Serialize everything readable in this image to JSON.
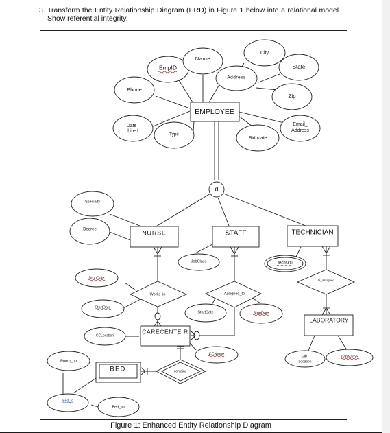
{
  "question": {
    "number": "3.",
    "text": "Transform the Entity Relationship Diagram (ERD) in Figure 1 below into a relational model. Show referential integrity."
  },
  "figure": {
    "caption": "Figure 1: Enhanced Entity Relationship Diagram",
    "specialization_symbol": "d",
    "entities": {
      "employee": "EMPLOYEE",
      "nurse": "NURSE",
      "staff": "STAFF",
      "technician": "TECHNICIAN",
      "carecenter": "CARECENTE R",
      "laboratory": "LABORATORY",
      "bed": "BED"
    },
    "relationships": {
      "works_in": "Works_in",
      "assigned_to": "Assigned_to",
      "is_assigned": "Is_assigned",
      "contains": "contains"
    },
    "attributes": {
      "empid": "EmpID",
      "name": "Name",
      "city": "City",
      "state": "State",
      "address": "Address",
      "zip": "Zip",
      "phone": "Phone",
      "date_hired_1": "Date_",
      "date_hired_2": "hired",
      "type": "Type",
      "birthdate": "Birthdate",
      "email_1": "Email_",
      "email_2": "Address",
      "specialty": "Specialty",
      "degree": "Degree",
      "jobclass": "JobClass",
      "techskill": "techskill",
      "nurse_stopdate": "StopDate",
      "nurse_startdate": "StartDate",
      "staff_startdate": "StartDate",
      "staff_stopdate": "StopDate",
      "cclocation": "CCLocation",
      "ccname": "CCName",
      "lab_location_1": "Lab_",
      "lab_location_2": "Location",
      "labname": "LabName",
      "room_no": "Room_no",
      "bed_id": "Bed_id",
      "bed_no": "Bed_no"
    },
    "colors": {
      "spellcheck_underline": "#d21f1f",
      "link_text": "#1f4fa8"
    }
  }
}
